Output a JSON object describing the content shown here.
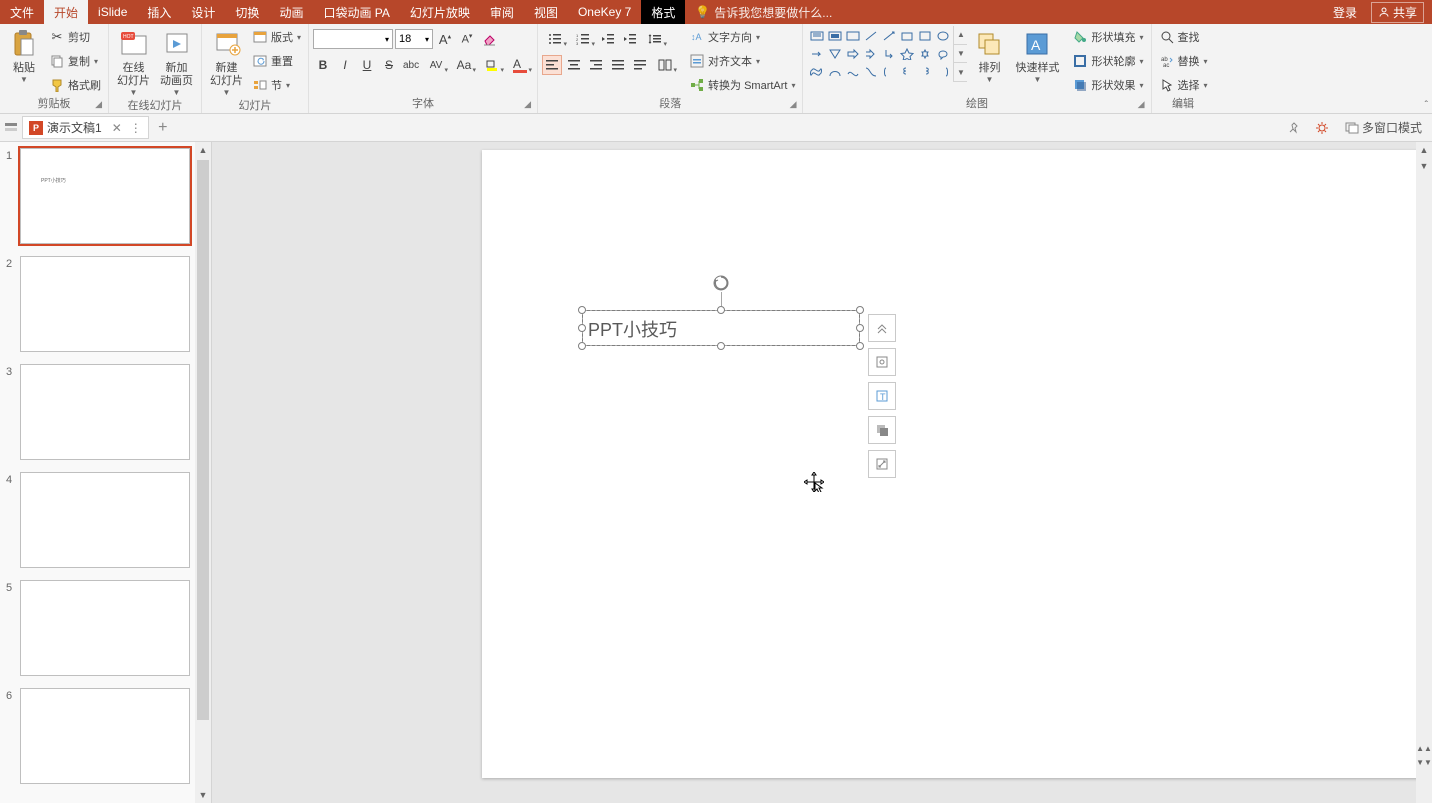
{
  "titlebar": {
    "tabs": [
      "文件",
      "开始",
      "iSlide",
      "插入",
      "设计",
      "切换",
      "动画",
      "口袋动画 PA",
      "幻灯片放映",
      "审阅",
      "视图",
      "OneKey 7",
      "格式"
    ],
    "active_tab_index": 1,
    "format_tab_index": 12,
    "tell_me_placeholder": "告诉我您想要做什么...",
    "login": "登录",
    "share": "共享"
  },
  "ribbon": {
    "clipboard": {
      "paste": "粘贴",
      "cut": "剪切",
      "copy": "复制",
      "format_painter": "格式刷",
      "label": "剪贴板"
    },
    "online_slides": {
      "online_slide": "在线\n幻灯片",
      "new_anim": "新加\n动画页",
      "label": "在线幻灯片"
    },
    "slides": {
      "new_slide": "新建\n幻灯片",
      "layout": "版式",
      "reset": "重置",
      "section": "节",
      "label": "幻灯片"
    },
    "font": {
      "name": "",
      "size": "18",
      "label": "字体"
    },
    "paragraph": {
      "text_direction": "文字方向",
      "align_text": "对齐文本",
      "convert_smartart": "转换为 SmartArt",
      "label": "段落"
    },
    "drawing": {
      "arrange": "排列",
      "quick_styles": "快速样式",
      "shape_fill": "形状填充",
      "shape_outline": "形状轮廓",
      "shape_effects": "形状效果",
      "label": "绘图"
    },
    "editing": {
      "find": "查找",
      "replace": "替换",
      "select": "选择",
      "label": "编辑"
    }
  },
  "doc_tabs": {
    "doc_name": "演示文稿1",
    "multi_window": "多窗口模式"
  },
  "slides_panel": {
    "count": 6,
    "selected": 1
  },
  "slide": {
    "textbox_text": "PPT小技巧"
  },
  "float_strip": {
    "items": [
      "collapse-icon",
      "layout-options-icon",
      "text-icon",
      "duplicate-icon",
      "size-icon"
    ]
  }
}
